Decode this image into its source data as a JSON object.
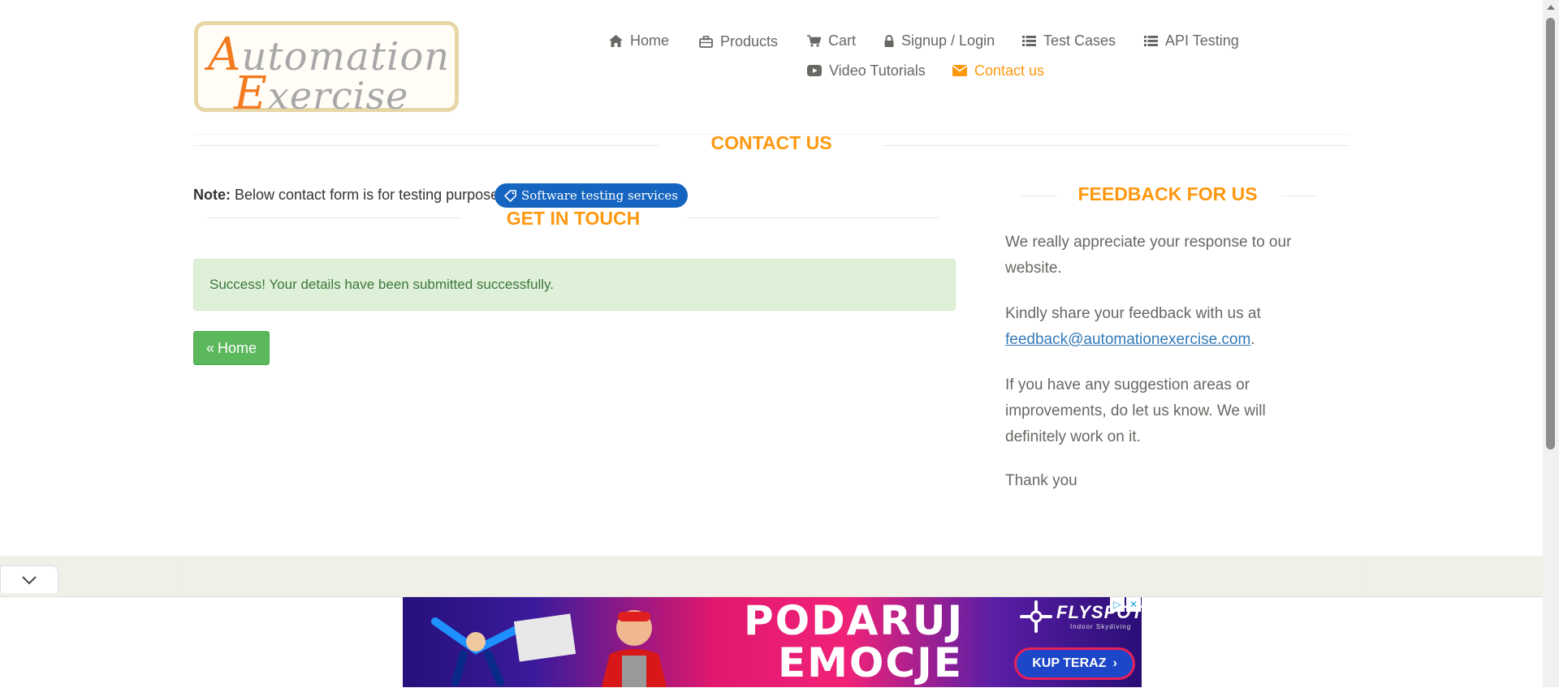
{
  "logo": {
    "line1_cap": "A",
    "line1_rest": "utomation",
    "line2_cap": "E",
    "line2_rest": "xercise"
  },
  "nav": {
    "home": "Home",
    "products": "Products",
    "cart": "Cart",
    "signup_login": "Signup / Login",
    "test_cases": "Test Cases",
    "api_testing": "API Testing",
    "video_tutorials": "Video Tutorials",
    "contact_us": "Contact us"
  },
  "contact": {
    "title": "CONTACT US",
    "note_label": "Note:",
    "note_text": " Below contact form is for testing purpose.",
    "badge": "Software testing services",
    "get_in_touch": "GET IN TOUCH",
    "success": "Success! Your details have been submitted successfully.",
    "home_button": "Home"
  },
  "feedback": {
    "title": "FEEDBACK FOR US",
    "p1": "We really appreciate your response to our website.",
    "p2_text": "Kindly share your feedback with us at ",
    "p2_email": "feedback@automationexercise.com",
    "p2_end": ".",
    "p3": "If you have any suggestion areas or improvements, do let us know. We will definitely work on it.",
    "p4": "Thank you"
  },
  "ad": {
    "headline1": "PODARUJ",
    "headline2": "EMOCJE",
    "brand": "FLYSPOT",
    "brand_sub": "Indoor Skydiving",
    "cta": "KUP TERAZ",
    "close": "✕"
  },
  "colors": {
    "accent": "#fe980f",
    "success_bg": "#dff0d8",
    "button": "#5cb85c",
    "badge": "#1565c0"
  }
}
